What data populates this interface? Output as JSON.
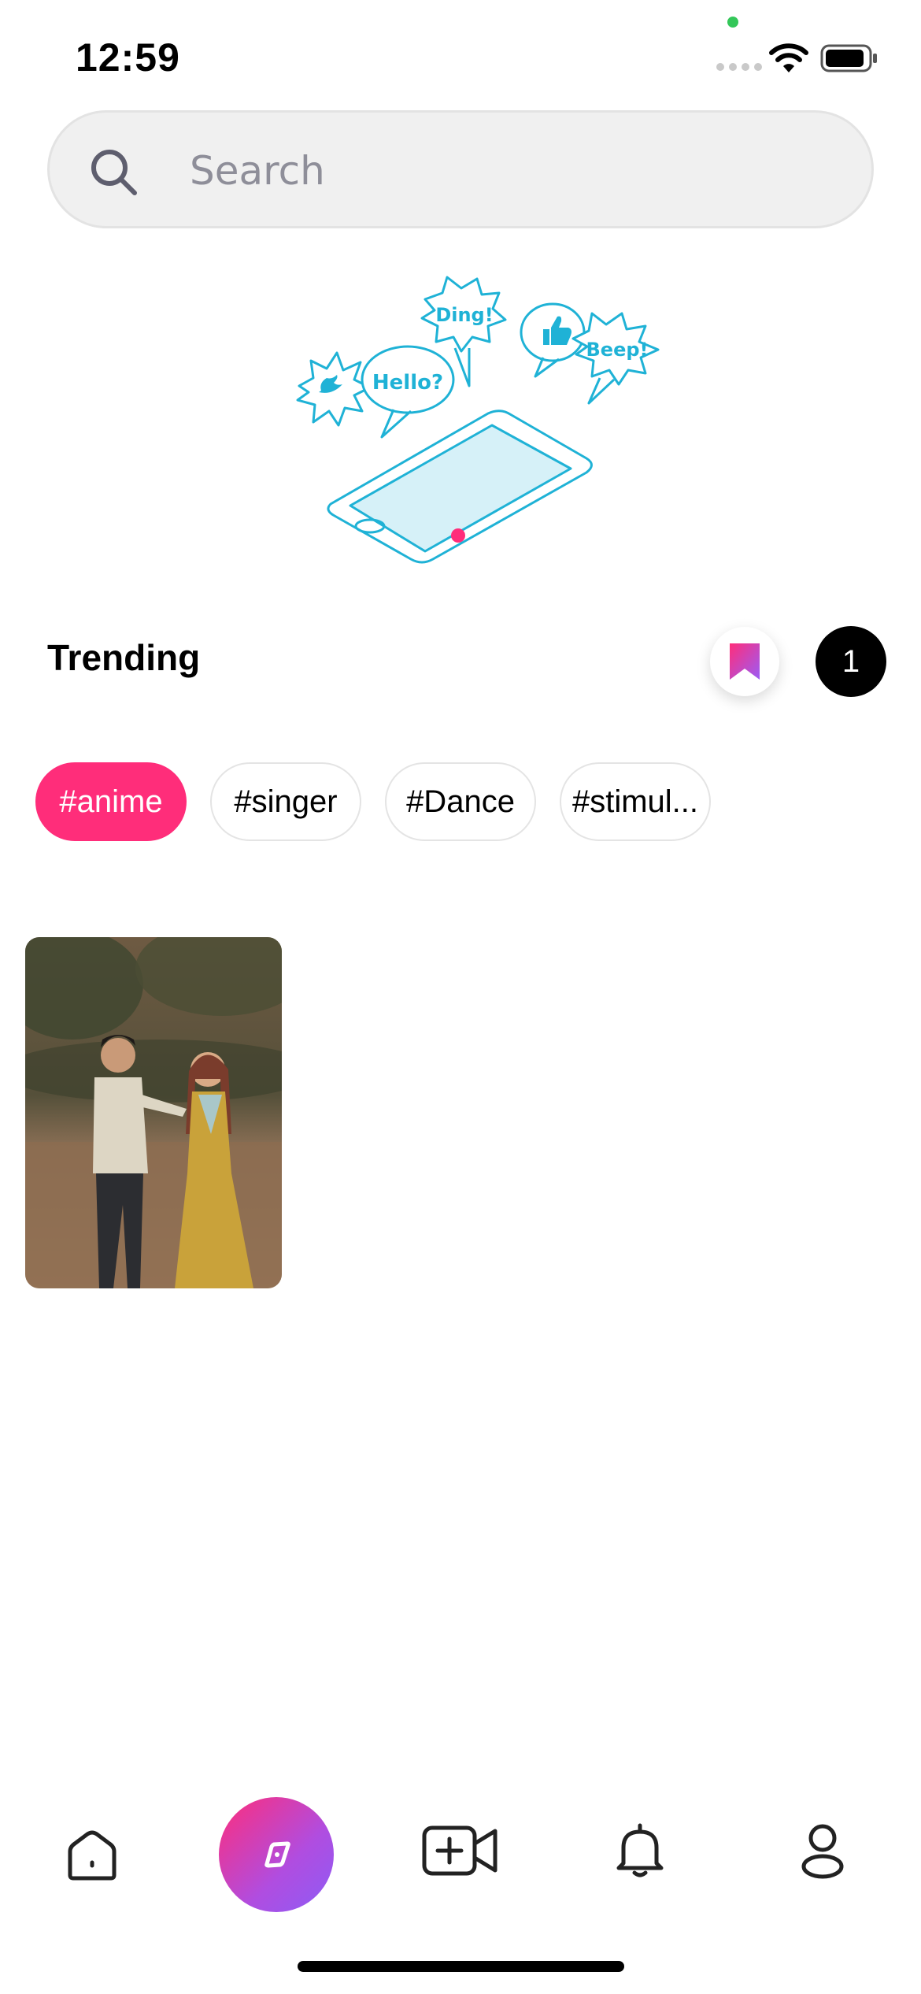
{
  "status_bar": {
    "time": "12:59"
  },
  "search": {
    "placeholder": "Search"
  },
  "illustration": {
    "bubbles": [
      "Ding!",
      "Hello?",
      "Beep!"
    ]
  },
  "trending": {
    "title": "Trending",
    "count": "1"
  },
  "hashtags": [
    "#anime",
    "#singer",
    "#Dance",
    "#stimul..."
  ],
  "colors": {
    "accent": "#ff2d7a",
    "illustration": "#1fb2d6",
    "explore_gradient_end": "#8d5cf6"
  },
  "nav": {
    "items": [
      "home-icon",
      "explore-icon",
      "add-video-icon",
      "bell-icon",
      "profile-icon"
    ],
    "active": "explore-icon"
  }
}
